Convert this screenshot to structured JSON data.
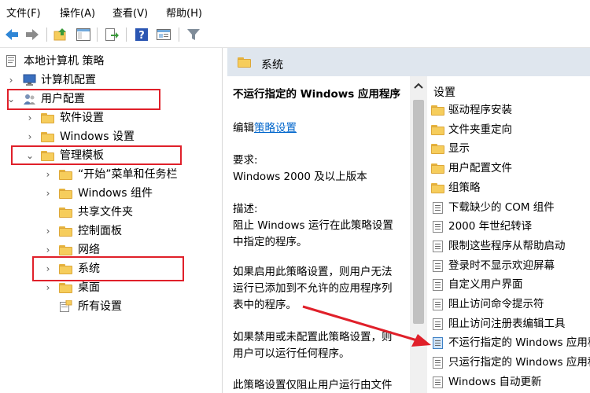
{
  "menubar": [
    "文件(F)",
    "操作(A)",
    "查看(V)",
    "帮助(H)"
  ],
  "toolbar": {
    "icons": [
      "back-arrow-icon",
      "forward-arrow-icon",
      "up-folder-icon",
      "show-hide-tree-icon",
      "export-list-icon",
      "help-icon",
      "properties-icon",
      "filter-icon"
    ]
  },
  "tree": {
    "root": "本地计算机 策略",
    "computer_config": "计算机配置",
    "user_config": "用户配置",
    "software_settings": "软件设置",
    "windows_settings": "Windows 设置",
    "admin_templates": "管理模板",
    "start_menu": "“开始”菜单和任务栏",
    "windows_components": "Windows 组件",
    "shared_folders": "共享文件夹",
    "control_panel": "控制面板",
    "network": "网络",
    "system": "系统",
    "desktop": "桌面",
    "all_settings": "所有设置"
  },
  "details": {
    "header": "系统",
    "policy_title": "不运行指定的 Windows 应用程序",
    "edit_prefix": "编辑",
    "edit_link": "策略设置",
    "requirement_label": "要求:",
    "requirement_value": "Windows 2000 及以上版本",
    "description_label": "描述:",
    "desc_line1": "阻止 Windows 运行在此策略设置",
    "desc_line2": "中指定的程序。",
    "enable_line1": "如果启用此策略设置，则用户无法",
    "enable_line2": "运行已添加到不允许的应用程序列",
    "enable_line3": "表中的程序。",
    "disable_line1": "如果禁用或未配置此策略设置，则",
    "disable_line2": "用户可以运行任何程序。",
    "more_line1": "此策略设置仅阻止用户运行由文件"
  },
  "settings": {
    "header": "设置",
    "items": [
      {
        "label": "驱动程序安装",
        "kind": "folder"
      },
      {
        "label": "文件夹重定向",
        "kind": "folder"
      },
      {
        "label": "显示",
        "kind": "folder"
      },
      {
        "label": "用户配置文件",
        "kind": "folder"
      },
      {
        "label": "组策略",
        "kind": "folder"
      },
      {
        "label": "下载缺少的 COM 组件",
        "kind": "policy"
      },
      {
        "label": "2000 年世纪转译",
        "kind": "policy"
      },
      {
        "label": "限制这些程序从帮助启动",
        "kind": "policy"
      },
      {
        "label": "登录时不显示欢迎屏幕",
        "kind": "policy"
      },
      {
        "label": "自定义用户界面",
        "kind": "policy"
      },
      {
        "label": "阻止访问命令提示符",
        "kind": "policy"
      },
      {
        "label": "阻止访问注册表编辑工具",
        "kind": "policy"
      },
      {
        "label": "不运行指定的 Windows 应用程序",
        "kind": "policy"
      },
      {
        "label": "只运行指定的 Windows 应用程序",
        "kind": "policy"
      },
      {
        "label": "Windows 自动更新",
        "kind": "policy"
      }
    ]
  },
  "colors": {
    "highlight": "#e0202a",
    "link": "#0066cc",
    "header_bg": "#dfe6ee",
    "folder": "#f6cd5c"
  }
}
